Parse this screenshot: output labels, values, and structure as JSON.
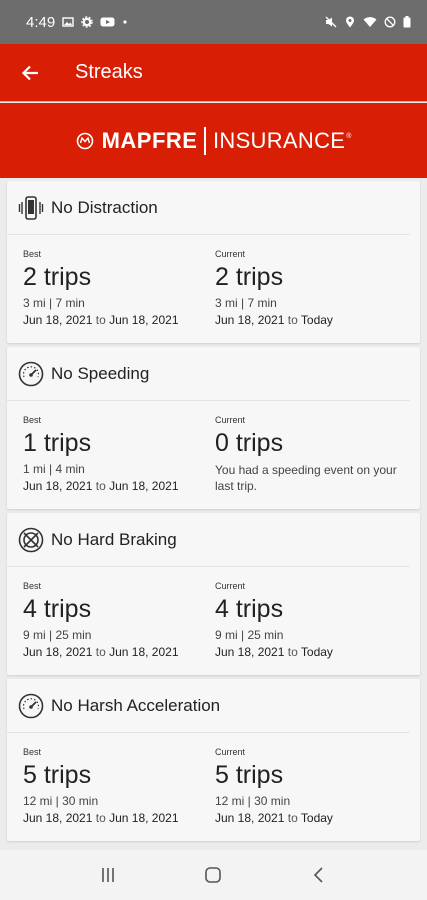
{
  "status_bar": {
    "time": "4:49",
    "left_icons": [
      "image-icon",
      "gear-icon",
      "youtube-icon",
      "dot-icon"
    ],
    "right_icons": [
      "mute-icon",
      "location-icon",
      "wifi-icon",
      "do-not-disturb-icon",
      "battery-icon"
    ]
  },
  "app_bar": {
    "title": "Streaks"
  },
  "banner": {
    "brand": "MAPFRE",
    "suffix": "INSURANCE",
    "reg": "®"
  },
  "cards": [
    {
      "title": "No Distraction",
      "icon": "phone-vibrate-icon",
      "best": {
        "label": "Best",
        "value": "2 trips",
        "distance": "3 mi | 7 min",
        "start": "Jun 18, 2021",
        "to": "to",
        "end": "Jun 18, 2021"
      },
      "current": {
        "label": "Current",
        "value": "2 trips",
        "distance": "3 mi | 7 min",
        "start": "Jun 18, 2021",
        "to": "to",
        "end": "Today"
      }
    },
    {
      "title": "No Speeding",
      "icon": "speedometer-icon",
      "best": {
        "label": "Best",
        "value": "1 trips",
        "distance": "1 mi | 4 min",
        "start": "Jun 18, 2021",
        "to": "to",
        "end": "Jun 18, 2021"
      },
      "current": {
        "label": "Current",
        "value": "0 trips",
        "message": "You had a speeding event on your last trip."
      }
    },
    {
      "title": "No Hard Braking",
      "icon": "brake-icon",
      "best": {
        "label": "Best",
        "value": "4 trips",
        "distance": "9 mi | 25 min",
        "start": "Jun 18, 2021",
        "to": "to",
        "end": "Jun 18, 2021"
      },
      "current": {
        "label": "Current",
        "value": "4 trips",
        "distance": "9 mi | 25 min",
        "start": "Jun 18, 2021",
        "to": "to",
        "end": "Today"
      }
    },
    {
      "title": "No Harsh Acceleration",
      "icon": "speedometer-icon",
      "best": {
        "label": "Best",
        "value": "5 trips",
        "distance": "12 mi | 30 min",
        "start": "Jun 18, 2021",
        "to": "to",
        "end": "Jun 18, 2021"
      },
      "current": {
        "label": "Current",
        "value": "5 trips",
        "distance": "12 mi | 30 min",
        "start": "Jun 18, 2021",
        "to": "to",
        "end": "Today"
      }
    }
  ],
  "nav_bar": {
    "buttons": [
      "recents-icon",
      "home-icon",
      "back-icon"
    ]
  },
  "colors": {
    "brand_red": "#d81e05",
    "status_gray": "#6d6d6d"
  }
}
